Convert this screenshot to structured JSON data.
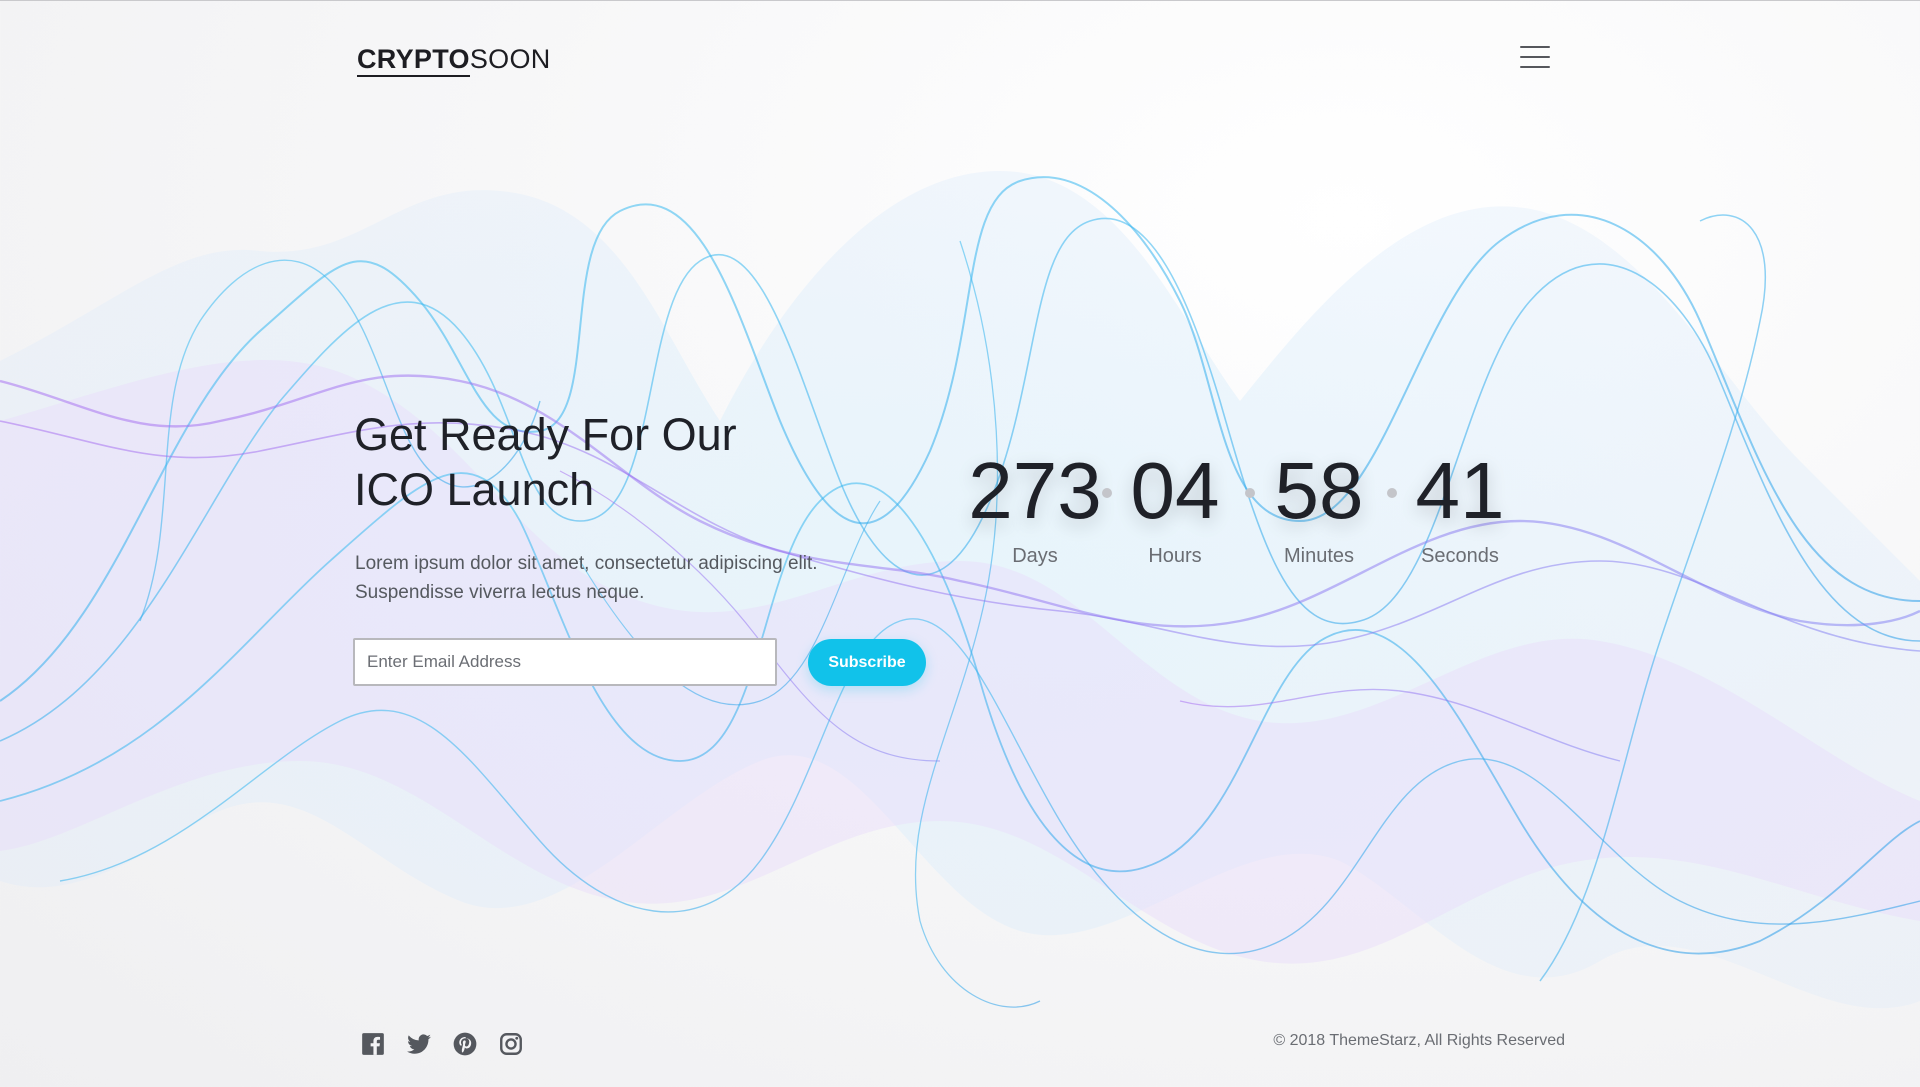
{
  "header": {
    "logo_bold": "CRYPTO",
    "logo_light": "SOON",
    "menu_icon": "hamburger-menu-icon"
  },
  "hero": {
    "title_line1": "Get Ready For Our",
    "title_line2": "ICO Launch",
    "desc_line1": "Lorem ipsum dolor sit amet, consectetur adipiscing elit.",
    "desc_line2": "Suspendisse viverra lectus neque.",
    "email_placeholder": "Enter Email Address",
    "subscribe_label": "Subscribe"
  },
  "countdown": {
    "units": [
      {
        "value": "273",
        "label": "Days"
      },
      {
        "value": "04",
        "label": "Hours"
      },
      {
        "value": "58",
        "label": "Minutes"
      },
      {
        "value": "41",
        "label": "Seconds"
      }
    ]
  },
  "footer": {
    "social_icons": [
      "facebook-icon",
      "twitter-icon",
      "pinterest-icon",
      "instagram-icon"
    ],
    "copyright": "© 2018 ThemeStarz, All Rights Reserved"
  },
  "colors": {
    "accent": "#11c2ea",
    "wave_blue": "#2fb3ee",
    "wave_purple": "#9a6cf0",
    "text_dark": "#1f2128"
  }
}
